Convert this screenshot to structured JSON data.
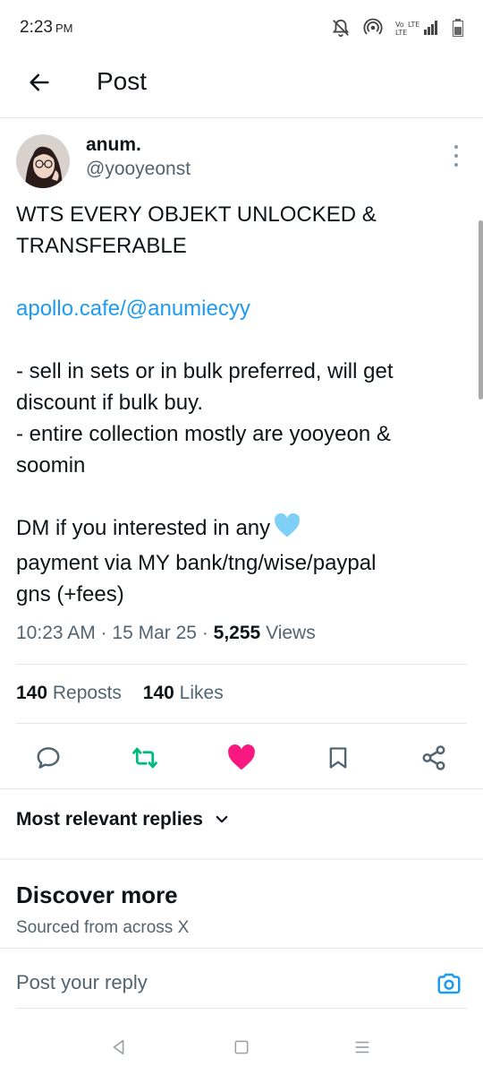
{
  "status_bar": {
    "time": "2:23",
    "ampm": "PM",
    "icons": [
      "mute-bell-icon",
      "hotspot-icon",
      "volte-lte-signal-icon",
      "battery-icon"
    ]
  },
  "header": {
    "title": "Post",
    "back_icon": "arrow-left-icon"
  },
  "author": {
    "name": "anum.",
    "handle": "@yooyeonst",
    "avatar": "profile-photo"
  },
  "post": {
    "lines": [
      "WTS EVERY OBJEKT UNLOCKED &",
      "TRANSFERABLE",
      "apollo.cafe/@anumiecyy",
      "- sell in sets or in bulk preferred, will get",
      "discount if bulk buy.",
      "- entire collection mostly are yooyeon &",
      "soomin",
      "DM if you interested in any",
      "payment via MY bank/tng/wise/paypal",
      "gns (+fees)"
    ],
    "link_color": "#1d9bf0",
    "emoji": "light-blue-heart"
  },
  "meta": {
    "time": "10:23 AM",
    "sep1": "·",
    "date": "15 Mar 25",
    "sep2": "·",
    "views_count": "5,255",
    "views_label": "Views"
  },
  "stats": {
    "reposts_count": "140",
    "reposts_label": "Reposts",
    "likes_count": "140",
    "likes_label": "Likes"
  },
  "actions": {
    "reply_icon": "reply-icon",
    "repost_icon": "repost-icon",
    "like_icon": "heart-icon",
    "bookmark_icon": "bookmark-icon",
    "share_icon": "share-icon",
    "repost_color": "#00ba7c",
    "like_color": "#f91880"
  },
  "replies": {
    "sort_label": "Most relevant replies"
  },
  "discover": {
    "title": "Discover more",
    "subtitle": "Sourced from across X"
  },
  "reply_bar": {
    "placeholder": "Post your reply",
    "camera_color": "#1d9bf0"
  },
  "nav": {
    "icons": [
      "nav-back-icon",
      "nav-home-icon",
      "nav-menu-icon"
    ]
  }
}
